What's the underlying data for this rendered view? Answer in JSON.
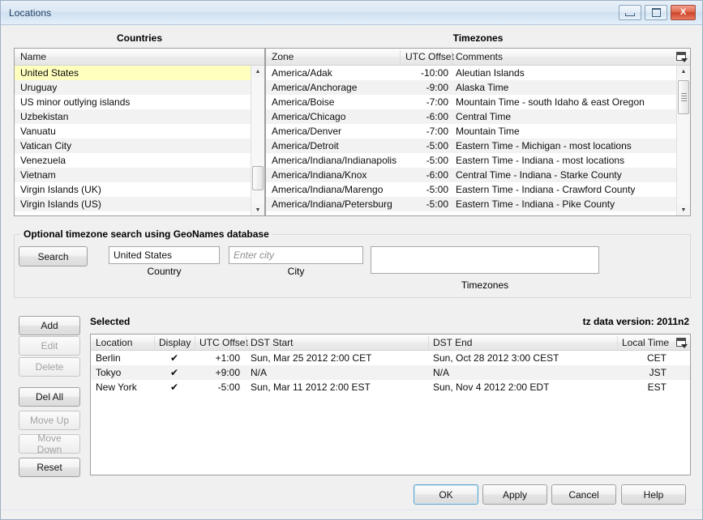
{
  "window": {
    "title": "Locations",
    "buttons": {
      "minimize": "minimize",
      "maximize": "maximize",
      "close": "X"
    }
  },
  "countries_panel": {
    "title": "Countries",
    "header": "Name",
    "selected_index": 0,
    "items": [
      "United States",
      "Uruguay",
      "US minor outlying islands",
      "Uzbekistan",
      "Vanuatu",
      "Vatican City",
      "Venezuela",
      "Vietnam",
      "Virgin Islands (UK)",
      "Virgin Islands (US)"
    ]
  },
  "timezones_panel": {
    "title": "Timezones",
    "headers": [
      "Zone",
      "UTC Offset",
      "Comments"
    ],
    "rows": [
      {
        "zone": "America/Adak",
        "offset": "-10:00",
        "comment": "Aleutian Islands"
      },
      {
        "zone": "America/Anchorage",
        "offset": "-9:00",
        "comment": "Alaska Time"
      },
      {
        "zone": "America/Boise",
        "offset": "-7:00",
        "comment": "Mountain Time - south Idaho & east Oregon"
      },
      {
        "zone": "America/Chicago",
        "offset": "-6:00",
        "comment": "Central Time"
      },
      {
        "zone": "America/Denver",
        "offset": "-7:00",
        "comment": "Mountain Time"
      },
      {
        "zone": "America/Detroit",
        "offset": "-5:00",
        "comment": "Eastern Time - Michigan - most locations"
      },
      {
        "zone": "America/Indiana/Indianapolis",
        "offset": "-5:00",
        "comment": "Eastern Time - Indiana - most locations"
      },
      {
        "zone": "America/Indiana/Knox",
        "offset": "-6:00",
        "comment": "Central Time - Indiana - Starke County"
      },
      {
        "zone": "America/Indiana/Marengo",
        "offset": "-5:00",
        "comment": "Eastern Time - Indiana - Crawford County"
      },
      {
        "zone": "America/Indiana/Petersburg",
        "offset": "-5:00",
        "comment": "Eastern Time - Indiana - Pike County"
      }
    ]
  },
  "search": {
    "group_label": "Optional timezone search using GeoNames database",
    "search_button": "Search",
    "country_value": "United States",
    "country_label": "Country",
    "city_value": "",
    "city_placeholder": "Enter city",
    "city_label": "City",
    "results_value": "",
    "results_label": "Timezones"
  },
  "side_buttons": [
    {
      "label": "Add",
      "disabled": false
    },
    {
      "label": "Edit",
      "disabled": true
    },
    {
      "label": "Delete",
      "disabled": true
    },
    {
      "label": "Del All",
      "disabled": false
    },
    {
      "label": "Move Up",
      "disabled": true
    },
    {
      "label": "Move Down",
      "disabled": true
    },
    {
      "label": "Reset",
      "disabled": false
    }
  ],
  "selected_panel": {
    "title": "Selected",
    "tz_version": "tz data version: 2011n2",
    "headers": [
      "Location",
      "Display",
      "UTC Offset",
      "DST Start",
      "DST End",
      "Local Time"
    ],
    "rows": [
      {
        "location": "Berlin",
        "display": "✔",
        "offset": "+1:00",
        "dst_start": "Sun, Mar 25 2012 2:00 CET",
        "dst_end": "Sun, Oct 28 2012 3:00 CEST",
        "local_time": "CET"
      },
      {
        "location": "Tokyo",
        "display": "✔",
        "offset": "+9:00",
        "dst_start": "N/A",
        "dst_end": "N/A",
        "local_time": "JST"
      },
      {
        "location": "New York",
        "display": "✔",
        "offset": "-5:00",
        "dst_start": "Sun, Mar 11 2012 2:00 EST",
        "dst_end": "Sun, Nov 4 2012 2:00 EDT",
        "local_time": "EST"
      }
    ]
  },
  "dialog_buttons": [
    {
      "label": "OK",
      "default": true
    },
    {
      "label": "Apply",
      "default": false
    },
    {
      "label": "Cancel",
      "default": false
    },
    {
      "label": "Help",
      "default": false
    }
  ],
  "colors": {
    "selection": "#ffffbe",
    "alt_row": "#f2f2f2",
    "window_bg": "#f0f0f0",
    "titlebar": "#dce8f4",
    "close_button": "#cd442a",
    "default_button_border": "#5ba3c9"
  }
}
